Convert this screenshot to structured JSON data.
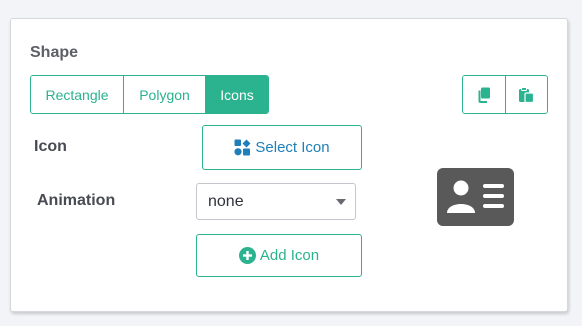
{
  "shape": {
    "title": "Shape",
    "options": [
      "Rectangle",
      "Polygon",
      "Icons"
    ],
    "selected": "Icons"
  },
  "toolbar": {
    "copy_icon": "copy-icon",
    "paste_icon": "paste-icon"
  },
  "icon_row": {
    "label": "Icon",
    "select_button_label": "Select Icon",
    "select_button_icon": "icons-icon"
  },
  "animation_row": {
    "label": "Animation",
    "value": "none"
  },
  "add_button": {
    "label": "Add Icon",
    "icon": "plus-circle-icon"
  },
  "preview": {
    "icon": "id-card-icon",
    "color": "#595959"
  },
  "colors": {
    "accent": "#2bb28f",
    "link_blue": "#1f7fb8"
  }
}
